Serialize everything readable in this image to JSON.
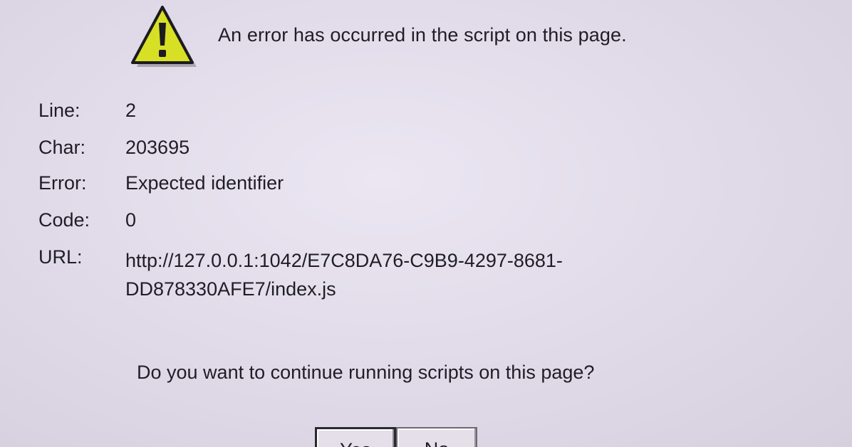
{
  "dialog": {
    "message": "An error has occurred in the script on this page.",
    "icon": "warning-triangle-icon",
    "fields": {
      "line": {
        "label": "Line:",
        "value": "2"
      },
      "char": {
        "label": "Char:",
        "value": "203695"
      },
      "error": {
        "label": "Error:",
        "value": "Expected identifier"
      },
      "code": {
        "label": "Code:",
        "value": "0"
      },
      "url": {
        "label": "URL:",
        "value_line1": "http://127.0.0.1:1042/E7C8DA76-C9B9-4297-8681-",
        "value_line2": "DD878330AFE7/index.js"
      }
    },
    "question": "Do you want to continue running scripts on this page?",
    "buttons": {
      "yes": "Yes",
      "no": "No"
    }
  },
  "colors": {
    "background": "#e4dfea",
    "warning_yellow": "#d7e024",
    "text": "#1f1d26"
  }
}
